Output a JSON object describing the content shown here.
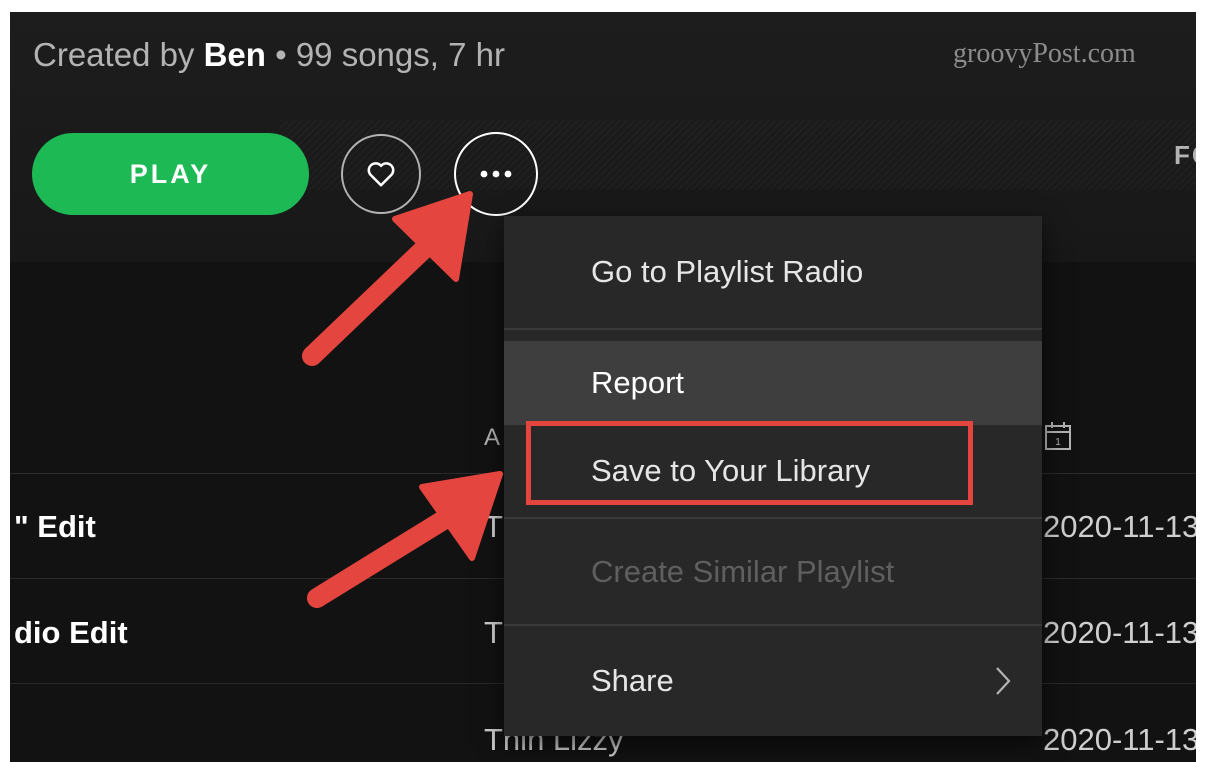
{
  "playlist": {
    "created_by_prefix": "Created by ",
    "author": "Ben",
    "stats": " • 99 songs, 7 hr"
  },
  "watermark": "groovyPost.com",
  "controls": {
    "play_label": "PLAY",
    "like_icon": "heart-icon",
    "more_icon": "more-horizontal-icon",
    "follower_fragment": "FO"
  },
  "table": {
    "column_header_fragment": "A",
    "date_icon": "calendar-icon",
    "rows": [
      {
        "title": "\" Edit",
        "artist": "T",
        "date": "2020-11-13"
      },
      {
        "title": "dio Edit",
        "artist": "T",
        "date": "2020-11-13"
      },
      {
        "title": "",
        "artist": "Thin Lizzy",
        "date": "2020-11-13"
      }
    ]
  },
  "context_menu": {
    "items": [
      {
        "label": "Go to Playlist Radio",
        "state": "normal"
      },
      {
        "label": "Report",
        "state": "hover"
      },
      {
        "label": "Save to Your Library",
        "state": "highlighted"
      },
      {
        "label": "Create Similar Playlist",
        "state": "disabled"
      },
      {
        "label": "Share",
        "state": "submenu"
      }
    ]
  },
  "colors": {
    "play_green": "#1db954",
    "annotation_red": "#e5453f",
    "menu_bg": "#282828"
  }
}
